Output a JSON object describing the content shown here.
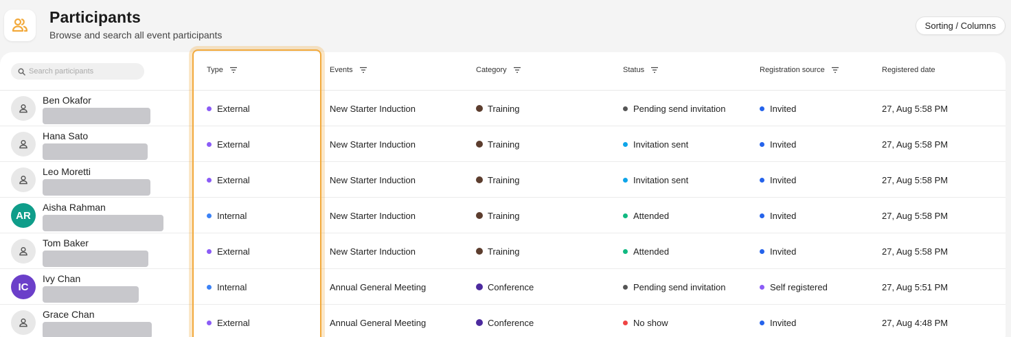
{
  "header": {
    "title": "Participants",
    "subtitle": "Browse and search all event participants",
    "sort_button": "Sorting / Columns"
  },
  "search": {
    "placeholder": "Search participants"
  },
  "columns": {
    "type": "Type",
    "events": "Events",
    "category": "Category",
    "status": "Status",
    "source": "Registration source",
    "date": "Registered date"
  },
  "colors": {
    "accent": "#f2a93b",
    "external": "#8b5cf6",
    "internal": "#3b82f6",
    "training": "#5c3d2e",
    "conference": "#4c2a9e",
    "pending": "#555555",
    "sent": "#0ea5e9",
    "attended": "#10b981",
    "noshow": "#ef4444",
    "invited": "#2563eb",
    "self": "#8b5cf6"
  },
  "rows": [
    {
      "name": "Ben Okafor",
      "avatar": "person-icon",
      "initials": "",
      "type": "External",
      "event": "New Starter Induction",
      "category": "Training",
      "status": "Pending send invitation",
      "source": "Invited",
      "date": "27, Aug 5:58 PM"
    },
    {
      "name": "Hana Sato",
      "avatar": "person-icon",
      "initials": "",
      "type": "External",
      "event": "New Starter Induction",
      "category": "Training",
      "status": "Invitation sent",
      "source": "Invited",
      "date": "27, Aug 5:58 PM"
    },
    {
      "name": "Leo Moretti",
      "avatar": "person-icon",
      "initials": "",
      "type": "External",
      "event": "New Starter Induction",
      "category": "Training",
      "status": "Invitation sent",
      "source": "Invited",
      "date": "27, Aug 5:58 PM"
    },
    {
      "name": "Aisha Rahman",
      "avatar": "initials",
      "initials": "AR",
      "type": "Internal",
      "event": "New Starter Induction",
      "category": "Training",
      "status": "Attended",
      "source": "Invited",
      "date": "27, Aug 5:58 PM"
    },
    {
      "name": "Tom Baker",
      "avatar": "person-icon",
      "initials": "",
      "type": "External",
      "event": "New Starter Induction",
      "category": "Training",
      "status": "Attended",
      "source": "Invited",
      "date": "27, Aug 5:58 PM"
    },
    {
      "name": "Ivy Chan",
      "avatar": "initials",
      "initials": "IC",
      "type": "Internal",
      "event": "Annual General Meeting",
      "category": "Conference",
      "status": "Pending send invitation",
      "source": "Self registered",
      "date": "27, Aug 5:51 PM"
    },
    {
      "name": "Grace Chan",
      "avatar": "person-icon",
      "initials": "",
      "type": "External",
      "event": "Annual General Meeting",
      "category": "Conference",
      "status": "No show",
      "source": "Invited",
      "date": "27, Aug 4:48 PM"
    }
  ]
}
